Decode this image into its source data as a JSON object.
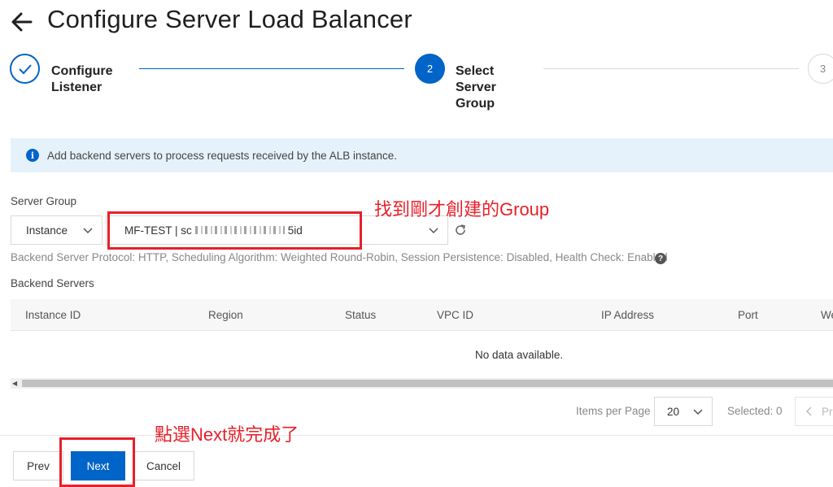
{
  "header": {
    "title": "Configure Server Load Balancer"
  },
  "stepper": {
    "step1": {
      "label": "Configure Listener"
    },
    "step2": {
      "number": "2",
      "label": "Select Server Group"
    },
    "step3": {
      "number": "3"
    }
  },
  "info": {
    "text": "Add backend servers to process requests received by the ALB instance."
  },
  "server_group": {
    "label": "Server Group",
    "type_value": "Instance",
    "group_value_prefix": "MF-TEST | sc",
    "group_value_suffix": "5id",
    "protocol_text": "Backend Server Protocol: HTTP, Scheduling Algorithm: Weighted Round-Robin, Session Persistence: Disabled, Health Check: Enabled"
  },
  "backend": {
    "label": "Backend Servers",
    "columns": [
      "Instance ID",
      "Region",
      "Status",
      "VPC ID",
      "IP Address",
      "Port",
      "We"
    ],
    "empty_text": "No data available."
  },
  "pagination": {
    "items_per_page_label": "Items per Page",
    "page_size": "20",
    "selected": "Selected: 0",
    "prev_label": "Pr"
  },
  "footer": {
    "prev": "Prev",
    "next": "Next",
    "cancel": "Cancel"
  },
  "annotations": {
    "find_group": "找到剛才創建的Group",
    "click_next": "點選Next就完成了"
  },
  "colors": {
    "primary": "#0064c8",
    "annotation": "#e8202a",
    "info_bg": "#e6f2fb"
  }
}
